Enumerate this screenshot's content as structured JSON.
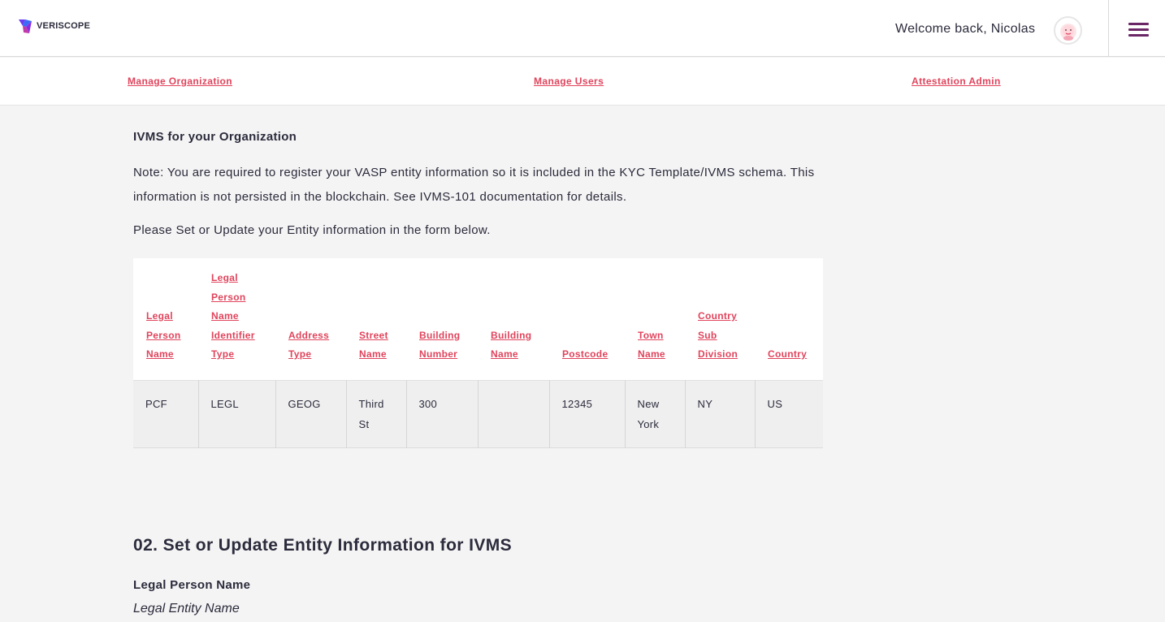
{
  "header": {
    "logo_text": "VERISCOPE",
    "welcome": "Welcome back, Nicolas"
  },
  "subnav": {
    "items": [
      {
        "label": "Manage Organization"
      },
      {
        "label": "Manage Users"
      },
      {
        "label": "Attestation Admin"
      }
    ]
  },
  "ivms": {
    "title": "IVMS for your Organization",
    "note": "Note: You are required to register your VASP entity information so it is included in the KYC Template/IVMS schema. This information is not persisted in the blockchain. See IVMS-101 documentation for details.",
    "instruction": "Please Set or Update your Entity information in the form below."
  },
  "table": {
    "columns": [
      "Legal Person Name",
      "Legal Person Name Identifier Type",
      "Address Type",
      "Street Name",
      "Building Number",
      "Building Name",
      "Postcode",
      "Town Name",
      "Country Sub Division",
      "Country"
    ],
    "rows": [
      [
        "PCF",
        "LEGL",
        "GEOG",
        "Third St",
        "300",
        "",
        "12345",
        "New York",
        "NY",
        "US"
      ]
    ]
  },
  "form": {
    "section_title": "02. Set or Update Entity Information for IVMS",
    "legal_person_name_label": "Legal Person Name",
    "legal_person_name_placeholder": "Legal Entity Name"
  },
  "colors": {
    "accent": "#e0445c",
    "menu": "#6b2666",
    "text": "#2b2b3c",
    "background": "#f4f4f4"
  }
}
